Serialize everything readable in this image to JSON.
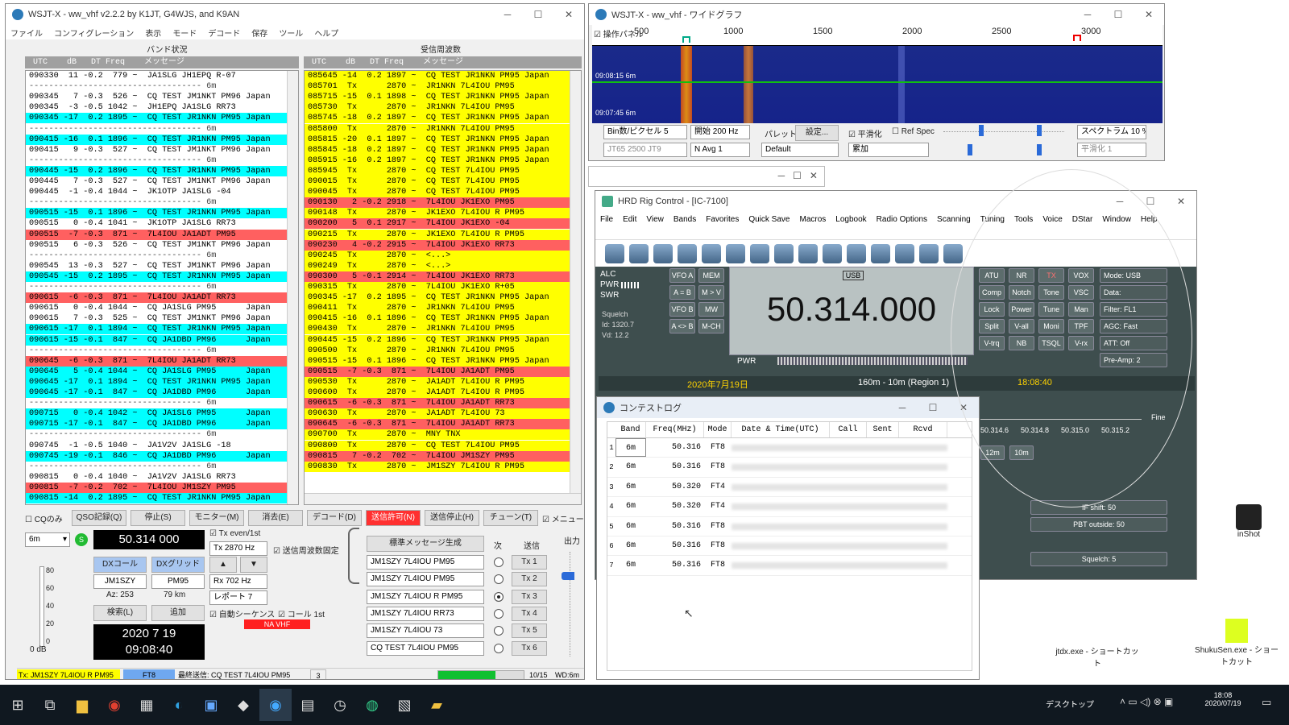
{
  "main": {
    "title": "WSJT-X - ww_vhf   v2.2.2   by K1JT, G4WJS, and K9AN",
    "menu": [
      "ファイル",
      "コンフィグレーション",
      "表示",
      "モード",
      "デコード",
      "保存",
      "ツール",
      "ヘルプ"
    ],
    "band_activity_label": "バンド状況",
    "rx_freq_label": "受信周波数",
    "col_header": " UTC    dB   DT Freq    メッセージ",
    "left_lines": [
      {
        "t": "090330  11 -0.2  779 ~  JA1SLG JH1EPQ R-07",
        "c": ""
      },
      {
        "t": "----------------------------------- 6m",
        "c": "sep"
      },
      {
        "t": "090345   7 -0.3  526 ~  CQ TEST JM1NKT PM96 Japan",
        "c": ""
      },
      {
        "t": "090345  -3 -0.5 1042 ~  JH1EPQ JA1SLG RR73",
        "c": ""
      },
      {
        "t": "090345 -17  0.2 1895 ~  CQ TEST JR1NKN PM95 Japan",
        "c": "cyan"
      },
      {
        "t": "----------------------------------- 6m",
        "c": "sep"
      },
      {
        "t": "090415 -16  0.1 1896 ~  CQ TEST JR1NKN PM95 Japan",
        "c": "cyan"
      },
      {
        "t": "090415   9 -0.3  527 ~  CQ TEST JM1NKT PM96 Japan",
        "c": ""
      },
      {
        "t": "----------------------------------- 6m",
        "c": "sep"
      },
      {
        "t": "090445 -15  0.2 1896 ~  CQ TEST JR1NKN PM95 Japan",
        "c": "cyan"
      },
      {
        "t": "090445   7 -0.3  527 ~  CQ TEST JM1NKT PM96 Japan",
        "c": ""
      },
      {
        "t": "090445  -1 -0.4 1044 ~  JK1OTP JA1SLG -04",
        "c": ""
      },
      {
        "t": "----------------------------------- 6m",
        "c": "sep"
      },
      {
        "t": "090515 -15  0.1 1896 ~  CQ TEST JR1NKN PM95 Japan",
        "c": "cyan"
      },
      {
        "t": "090515   0 -0.4 1041 ~  JK1OTP JA1SLG RR73",
        "c": ""
      },
      {
        "t": "090515  -7 -0.3  871 ~  7L4IOU JA1ADT PM95",
        "c": "red"
      },
      {
        "t": "090515   6 -0.3  526 ~  CQ TEST JM1NKT PM96 Japan",
        "c": ""
      },
      {
        "t": "----------------------------------- 6m",
        "c": "sep"
      },
      {
        "t": "090545  13 -0.3  527 ~  CQ TEST JM1NKT PM96 Japan",
        "c": ""
      },
      {
        "t": "090545 -15  0.2 1895 ~  CQ TEST JR1NKN PM95 Japan",
        "c": "cyan"
      },
      {
        "t": "----------------------------------- 6m",
        "c": "sep"
      },
      {
        "t": "090615  -6 -0.3  871 ~  7L4IOU JA1ADT RR73",
        "c": "red"
      },
      {
        "t": "090615   0 -0.4 1044 ~  CQ JA1SLG PM95      Japan",
        "c": ""
      },
      {
        "t": "090615   7 -0.3  525 ~  CQ TEST JM1NKT PM96 Japan",
        "c": ""
      },
      {
        "t": "090615 -17  0.1 1894 ~  CQ TEST JR1NKN PM95 Japan",
        "c": "cyan"
      },
      {
        "t": "090615 -15 -0.1  847 ~  CQ JA1DBD PM96      Japan",
        "c": "cyan"
      },
      {
        "t": "----------------------------------- 6m",
        "c": "sep"
      },
      {
        "t": "090645  -6 -0.3  871 ~  7L4IOU JA1ADT RR73",
        "c": "red"
      },
      {
        "t": "090645   5 -0.4 1044 ~  CQ JA1SLG PM95      Japan",
        "c": "cyan"
      },
      {
        "t": "090645 -17  0.1 1894 ~  CQ TEST JR1NKN PM95 Japan",
        "c": "cyan"
      },
      {
        "t": "090645 -17 -0.1  847 ~  CQ JA1DBD PM96      Japan",
        "c": "cyan"
      },
      {
        "t": "----------------------------------- 6m",
        "c": "sep"
      },
      {
        "t": "090715   0 -0.4 1042 ~  CQ JA1SLG PM95      Japan",
        "c": "cyan"
      },
      {
        "t": "090715 -17 -0.1  847 ~  CQ JA1DBD PM96      Japan",
        "c": "cyan"
      },
      {
        "t": "----------------------------------- 6m",
        "c": "sep"
      },
      {
        "t": "090745  -1 -0.5 1040 ~  JA1V2V JA1SLG -18",
        "c": ""
      },
      {
        "t": "090745 -19 -0.1  846 ~  CQ JA1DBD PM96      Japan",
        "c": "cyan"
      },
      {
        "t": "----------------------------------- 6m",
        "c": "sep"
      },
      {
        "t": "090815   0 -0.4 1040 ~  JA1V2V JA1SLG RR73",
        "c": ""
      },
      {
        "t": "090815  -7 -0.2  702 ~  7L4IOU JM1SZY PM95",
        "c": "red"
      },
      {
        "t": "090815 -14  0.2 1895 ~  CQ TEST JR1NKN PM95 Japan",
        "c": "cyan"
      }
    ],
    "right_lines": [
      {
        "t": "085645 -14  0.2 1897 ~  CQ TEST JR1NKN PM95 Japan",
        "c": "yellow"
      },
      {
        "t": "085701  Tx      2870 ~  JR1NKN 7L4IOU PM95",
        "c": "yellow"
      },
      {
        "t": "085715 -15  0.1 1898 ~  CQ TEST JR1NKN PM95 Japan",
        "c": "yellow"
      },
      {
        "t": "085730  Tx      2870 ~  JR1NKN 7L4IOU PM95",
        "c": "yellow"
      },
      {
        "t": "085745 -18  0.2 1897 ~  CQ TEST JR1NKN PM95 Japan",
        "c": "yellow"
      },
      {
        "t": "085800  Tx      2870 ~  JR1NKN 7L4IOU PM95",
        "c": "yellow"
      },
      {
        "t": "085815 -20  0.1 1897 ~  CQ TEST JR1NKN PM95 Japan",
        "c": "yellow"
      },
      {
        "t": "085845 -18  0.2 1897 ~  CQ TEST JR1NKN PM95 Japan",
        "c": "yellow"
      },
      {
        "t": "085915 -16  0.2 1897 ~  CQ TEST JR1NKN PM95 Japan",
        "c": "yellow"
      },
      {
        "t": "085945  Tx      2870 ~  CQ TEST 7L4IOU PM95",
        "c": "yellow"
      },
      {
        "t": "090015  Tx      2870 ~  CQ TEST 7L4IOU PM95",
        "c": "yellow"
      },
      {
        "t": "090045  Tx      2870 ~  CQ TEST 7L4IOU PM95",
        "c": "yellow"
      },
      {
        "t": "090130   2 -0.2 2918 ~  7L4IOU JK1EXO PM95",
        "c": "red"
      },
      {
        "t": "090148  Tx      2870 ~  JK1EXO 7L4IOU R PM95",
        "c": "yellow"
      },
      {
        "t": "090200   5  0.1 2917 ~  7L4IOU JK1EXO -04",
        "c": "red"
      },
      {
        "t": "090215  Tx      2870 ~  JK1EXO 7L4IOU R PM95",
        "c": "yellow"
      },
      {
        "t": "090230   4 -0.2 2915 ~  7L4IOU JK1EXO RR73",
        "c": "red"
      },
      {
        "t": "090245  Tx      2870 ~  <...>",
        "c": "yellow"
      },
      {
        "t": "090249  Tx      2870 ~  <...>",
        "c": "yellow"
      },
      {
        "t": "090300   5 -0.1 2914 ~  7L4IOU JK1EXO RR73",
        "c": "red"
      },
      {
        "t": "090315  Tx      2870 ~  7L4IOU JK1EXO R+05",
        "c": "yellow"
      },
      {
        "t": "090345 -17  0.2 1895 ~  CQ TEST JR1NKN PM95 Japan",
        "c": "yellow"
      },
      {
        "t": "090411  Tx      2870 ~  JR1NKN 7L4IOU PM95",
        "c": "yellow"
      },
      {
        "t": "090415 -16  0.1 1896 ~  CQ TEST JR1NKN PM95 Japan",
        "c": "yellow"
      },
      {
        "t": "090430  Tx      2870 ~  JR1NKN 7L4IOU PM95",
        "c": "yellow"
      },
      {
        "t": "090445 -15  0.2 1896 ~  CQ TEST JR1NKN PM95 Japan",
        "c": "yellow"
      },
      {
        "t": "090500  Tx      2870 ~  JR1NKN 7L4IOU PM95",
        "c": "yellow"
      },
      {
        "t": "090515 -15  0.1 1896 ~  CQ TEST JR1NKN PM95 Japan",
        "c": "yellow"
      },
      {
        "t": "090515  -7 -0.3  871 ~  7L4IOU JA1ADT PM95",
        "c": "red"
      },
      {
        "t": "090530  Tx      2870 ~  JA1ADT 7L4IOU R PM95",
        "c": "yellow"
      },
      {
        "t": "090600  Tx      2870 ~  JA1ADT 7L4IOU R PM95",
        "c": "yellow"
      },
      {
        "t": "090615  -6 -0.3  871 ~  7L4IOU JA1ADT RR73",
        "c": "red"
      },
      {
        "t": "090630  Tx      2870 ~  JA1ADT 7L4IOU 73",
        "c": "yellow"
      },
      {
        "t": "090645  -6 -0.3  871 ~  7L4IOU JA1ADT RR73",
        "c": "red"
      },
      {
        "t": "090700  Tx      2870 ~  MNY TNX",
        "c": "yellow"
      },
      {
        "t": "090800  Tx      2870 ~  CQ TEST 7L4IOU PM95",
        "c": "yellow"
      },
      {
        "t": "090815   7 -0.2  702 ~  7L4IOU JM1SZY PM95",
        "c": "red"
      },
      {
        "t": "090830  Tx      2870 ~  JM1SZY 7L4IOU R PM95",
        "c": "yellow"
      }
    ],
    "buttons": {
      "cq_only": "CQのみ",
      "log_qso": "QSO記録(Q)",
      "stop": "停止(S)",
      "monitor": "モニター(M)",
      "erase": "消去(E)",
      "decode": "デコード(D)",
      "enable_tx": "送信許可(N)",
      "halt_tx": "送信停止(H)",
      "tune": "チューン(T)",
      "menu": "メニュー"
    },
    "band": "6m",
    "s_indicator": "S",
    "dial_freq": "50.314 000",
    "tx_even": "Tx even/1st",
    "tx_freq": "Tx  2870  Hz",
    "hold_tx_freq": "送信周波数固定",
    "dx_call_label": "DXコール",
    "dx_grid_label": "DXグリッド",
    "dx_call": "JM1SZY",
    "dx_grid": "PM95",
    "az": "Az: 253",
    "dist": "79 km",
    "rx_freq": "Rx  702  Hz",
    "report": "レポート 7",
    "lookup": "検索(L)",
    "add": "追加",
    "auto_seq": "自動シーケンス",
    "call_1st": "コール 1st",
    "date": "2020 7 19",
    "time": "09:08:40",
    "na_vhf": "NA VHF",
    "meter_ticks": [
      "80",
      "60",
      "40",
      "20",
      "0"
    ],
    "meter_db": "0 dB",
    "gen_std": "標準メッセージ生成",
    "next_label": "次",
    "send_label": "送信",
    "out_label": "出力",
    "tx_msgs": [
      "JM1SZY 7L4IOU PM95",
      "JM1SZY 7L4IOU PM95",
      "JM1SZY 7L4IOU R PM95",
      "JM1SZY 7L4IOU RR73",
      "JM1SZY 7L4IOU 73",
      "CQ TEST 7L4IOU PM95"
    ],
    "tx_btns": [
      "Tx 1",
      "Tx 2",
      "Tx 3",
      "Tx 4",
      "Tx 5",
      "Tx 6"
    ],
    "status": {
      "tx": "Tx: JM1SZY 7L4IOU R PM95",
      "mode": "FT8",
      "last_tx": "最終送信: CQ TEST 7L4IOU PM95",
      "num": "3",
      "progress": "10/15",
      "wd": "WD:6m",
      "progress_value": 0.67
    }
  },
  "waterfall": {
    "title": "WSJT-X - ww_vhf - ワイドグラフ",
    "controls_label": "操作パネル",
    "ticks": [
      "500",
      "1000",
      "1500",
      "2000",
      "2500",
      "3000"
    ],
    "time1": "09:08:15",
    "band1": "6m",
    "time2": "09:07:45",
    "band2": "6m",
    "bins": "Bin数/ピクセル  5",
    "start": "開始  200 Hz",
    "palette": "パレット",
    "settings": "設定...",
    "flatten": "平滑化",
    "ref_spec": "Ref Spec",
    "spectrum": "スペクトラム 10 %",
    "jt65": "JT65  2500  JT9",
    "navg": "N Avg  1",
    "default": "Default",
    "cumulative": "累加",
    "smooth": "平滑化  1"
  },
  "hrd": {
    "title": "HRD Rig Control - [IC-7100]",
    "menu": [
      "File",
      "Edit",
      "View",
      "Bands",
      "Favorites",
      "Quick Save",
      "Macros",
      "Logbook",
      "Radio Options",
      "Scanning",
      "Tuning",
      "Tools",
      "Voice",
      "DStar",
      "Window"
    ],
    "help": "Help",
    "alc": "ALC",
    "pwr": "PWR",
    "swr": "SWR",
    "squelch": "Squelch",
    "id": "Id: 1320.7",
    "vd": "Vd: 12.2",
    "left_btns": [
      "VFO A",
      "MEM",
      "A = B",
      "M > V",
      "VFO B",
      "MW",
      "A <> B",
      "M-CH"
    ],
    "mode_tag": "USB",
    "freq": "50.314.000",
    "pwr2": "PWR",
    "date": "2020年7月19日",
    "band_range": "160m - 10m (Region 1)",
    "clock": "18:08:40",
    "right_btns": [
      "ATU",
      "NR",
      "TX",
      "VOX",
      "Comp",
      "Notch",
      "Tone",
      "VSC",
      "Lock",
      "Power",
      "Tune",
      "Man",
      "Split",
      "V-all",
      "Moni",
      "TPF",
      "V-trq",
      "NB",
      "TSQL",
      "V-rx"
    ],
    "right_sels": [
      "Mode: USB",
      "Data:",
      "Filter: FL1",
      "AGC: Fast",
      "ATT: Off",
      "Pre-Amp: 2"
    ],
    "scale": [
      "50.314.6",
      "50.314.8",
      "50.315.0",
      "50.315.2"
    ],
    "fine": "Fine",
    "bands": [
      "12m",
      "10m"
    ],
    "sliders": [
      "IF shift: 50",
      "PBT outside: 50",
      "Squelch: 5"
    ]
  },
  "contest_log": {
    "title": "コンテストログ",
    "headers": [
      "Band",
      "Freq(MHz)",
      "Mode",
      "Date & Time(UTC)",
      "Call",
      "Sent",
      "Rcvd"
    ],
    "rows": [
      {
        "n": "1",
        "band": "6m",
        "freq": "50.316",
        "mode": "FT8"
      },
      {
        "n": "2",
        "band": "6m",
        "freq": "50.316",
        "mode": "FT8"
      },
      {
        "n": "3",
        "band": "6m",
        "freq": "50.320",
        "mode": "FT4"
      },
      {
        "n": "4",
        "band": "6m",
        "freq": "50.320",
        "mode": "FT4"
      },
      {
        "n": "5",
        "band": "6m",
        "freq": "50.316",
        "mode": "FT8"
      },
      {
        "n": "6",
        "band": "6m",
        "freq": "50.316",
        "mode": "FT8"
      },
      {
        "n": "7",
        "band": "6m",
        "freq": "50.316",
        "mode": "FT8"
      }
    ]
  },
  "desktop": {
    "icon1": "inShot",
    "icon2": "jtdx.exe - ショートカット",
    "icon3": "ShukuSen.exe - ショートカット"
  },
  "taskbar": {
    "desktop": "デスクトップ",
    "time": "18:08",
    "date": "2020/07/19"
  }
}
